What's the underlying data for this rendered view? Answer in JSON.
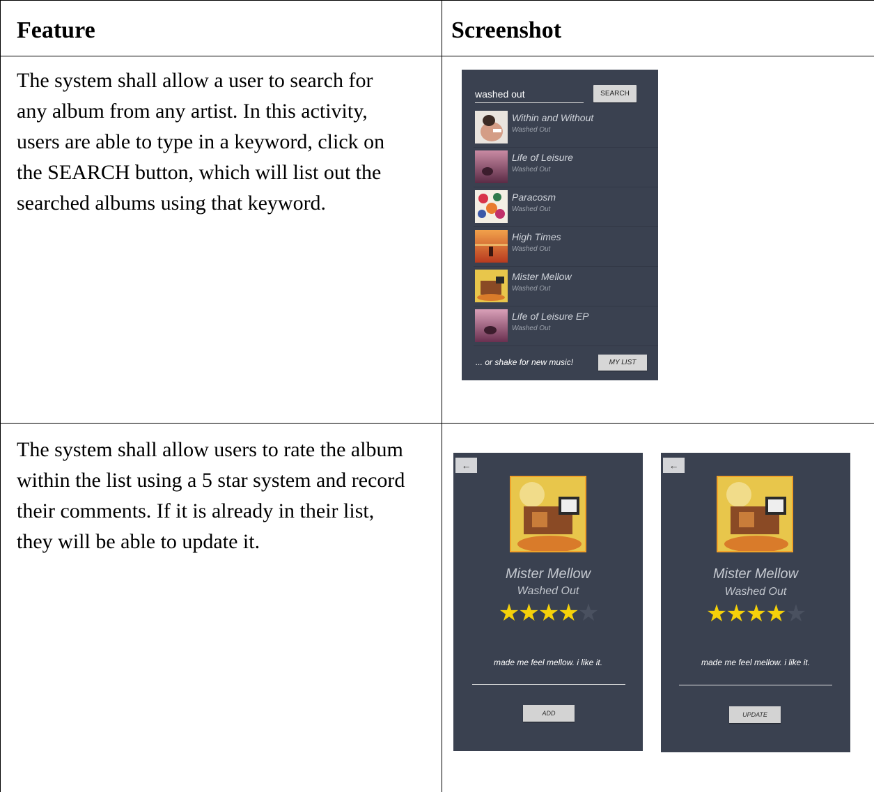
{
  "table": {
    "headers": {
      "feature": "Feature",
      "screenshot": "Screenshot"
    },
    "rows": [
      {
        "description_lines": [
          "The system shall allow a user to search for",
          "any album from any artist. In this activity,",
          "users are able to type in a keyword, click on",
          "the SEARCH button, which will list out the",
          "searched albums using that keyword."
        ]
      },
      {
        "description_lines": [
          "The system shall allow users to rate the album",
          "within the list using a 5 star system and record",
          "their comments. If it is already in their list,",
          "they will be able to update it."
        ]
      }
    ]
  },
  "search_screen": {
    "query": "washed out",
    "search_button": "SEARCH",
    "albums": [
      {
        "title": "Within and Without",
        "artist": "Washed Out",
        "icon": "album-cover-within-and-without"
      },
      {
        "title": "Life of Leisure",
        "artist": "Washed Out",
        "icon": "album-cover-life-of-leisure"
      },
      {
        "title": "Paracosm",
        "artist": "Washed Out",
        "icon": "album-cover-paracosm"
      },
      {
        "title": "High Times",
        "artist": "Washed Out",
        "icon": "album-cover-high-times"
      },
      {
        "title": "Mister Mellow",
        "artist": "Washed Out",
        "icon": "album-cover-mister-mellow"
      },
      {
        "title": "Life of Leisure EP",
        "artist": "Washed Out",
        "icon": "album-cover-life-of-leisure-ep"
      }
    ],
    "shake_text": "... or shake for new music!",
    "mylist_button": "MY LIST"
  },
  "detail_add": {
    "back_icon": "←",
    "title": "Mister Mellow",
    "artist": "Washed Out",
    "rating": 4,
    "max_rating": 5,
    "comment": "made me feel mellow. i like it.",
    "button": "ADD"
  },
  "detail_update": {
    "back_icon": "←",
    "title": "Mister Mellow",
    "artist": "Washed Out",
    "rating": 4,
    "max_rating": 5,
    "comment": "made me feel mellow. i like it.",
    "button": "UPDATE"
  },
  "colors": {
    "phone_bg": "#3a4150",
    "star_on": "#f5d10a",
    "star_off": "#4a5160",
    "cover_border": "#f0a22a"
  }
}
